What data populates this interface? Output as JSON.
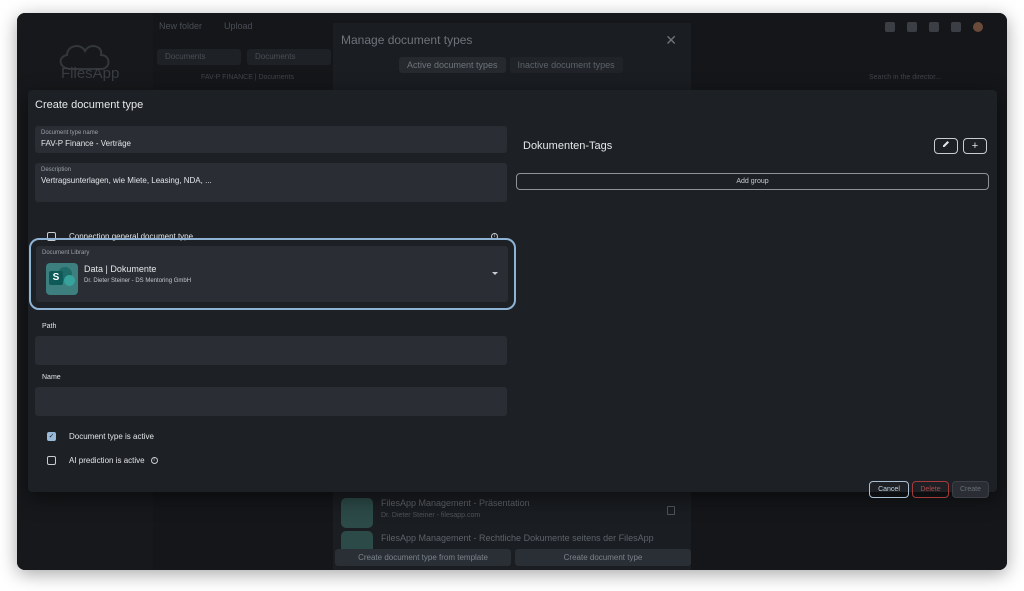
{
  "background_app": {
    "logo_text": "FilesApp",
    "toolbar": {
      "new_folder": "New folder",
      "upload": "Upload"
    },
    "tabs": [
      "Documents",
      "Documents"
    ],
    "path": "FAV-P FINANCE | Documents",
    "search_placeholder": "Search in the director..."
  },
  "manage_dialog": {
    "title": "Manage document types",
    "close": "✕",
    "tabs": {
      "active": "Active document types",
      "inactive": "Inactive document types"
    },
    "items": [
      {
        "title": "FilesApp Management - Präsentation",
        "sub": "Dr. Dieter Steiner - filesapp.com"
      },
      {
        "title": "FilesApp Management - Rechtliche Dokumente seitens der FilesApp",
        "sub": ""
      }
    ],
    "footer": {
      "from_template": "Create document type from template",
      "create": "Create document type"
    }
  },
  "create_dialog": {
    "title": "Create document type",
    "name_field": {
      "label": "Document type name",
      "value": "FAV-P Finance - Verträge"
    },
    "description_field": {
      "label": "Description",
      "value": "Vertragsunterlagen, wie Miete, Leasing, NDA, ..."
    },
    "connection_checkbox": {
      "label": "Connection general document type",
      "checked": false
    },
    "library": {
      "label": "Document Library",
      "title": "Data | Dokumente",
      "subtitle": "Dr. Dieter Steiner - DS Mentoring GmbH",
      "icon_letter": "S"
    },
    "path_label": "Path",
    "name_label": "Name",
    "active_checkbox": {
      "label": "Document type is active",
      "checked": true
    },
    "ai_checkbox": {
      "label": "AI prediction is active",
      "checked": false
    },
    "tags": {
      "title": "Dokumenten-Tags",
      "add_group": "Add group"
    },
    "buttons": {
      "cancel": "Cancel",
      "delete": "Delete",
      "create": "Create"
    }
  }
}
